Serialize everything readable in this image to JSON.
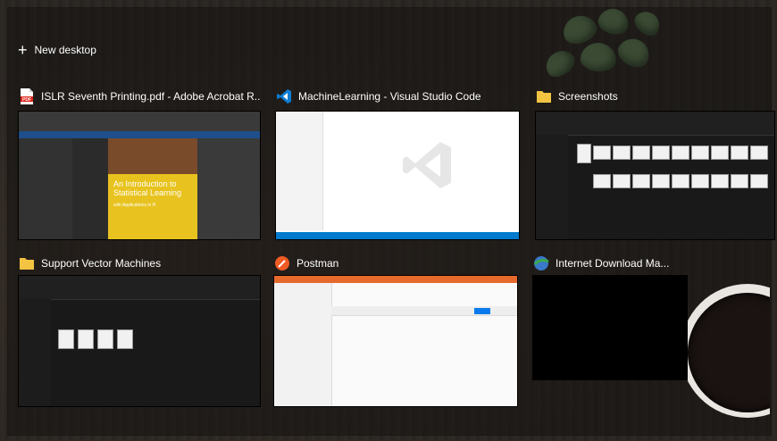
{
  "new_desktop": {
    "label": "New desktop",
    "icon": "plus-icon"
  },
  "windows": [
    {
      "title": "ISLR Seventh Printing.pdf - Adobe Acrobat R...",
      "icon": "acrobat-pdf-icon",
      "book_title": "An Introduction to Statistical Learning",
      "book_subtitle": "with Applications in R"
    },
    {
      "title": "MachineLearning - Visual Studio Code",
      "icon": "vscode-icon"
    },
    {
      "title": "Screenshots",
      "icon": "folder-icon"
    },
    {
      "title": "Support Vector Machines",
      "icon": "folder-icon"
    },
    {
      "title": "Postman",
      "icon": "postman-icon"
    },
    {
      "title": "Internet Download Ma...",
      "icon": "idm-icon"
    }
  ],
  "colors": {
    "acrobat_red": "#e0251b",
    "vscode_blue": "#0e7cd1",
    "folder_yellow": "#f3c442",
    "postman_orange": "#ef5b25",
    "idm_green": "#3aa84a"
  }
}
